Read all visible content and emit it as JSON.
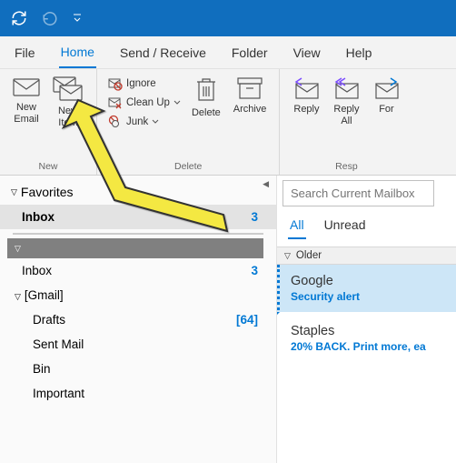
{
  "tabs": {
    "file": "File",
    "home": "Home",
    "send_receive": "Send / Receive",
    "folder": "Folder",
    "view": "View",
    "help": "Help"
  },
  "ribbon": {
    "new_group_label": "New",
    "delete_group_label": "Delete",
    "respond_group_label": "Resp",
    "new_email": "New\nEmail",
    "new_items": "New\nItem",
    "ignore": "Ignore",
    "clean_up": "Clean Up",
    "junk": "Junk",
    "delete": "Delete",
    "archive": "Archive",
    "reply": "Reply",
    "reply_all": "Reply\nAll",
    "forward": "For"
  },
  "sidebar": {
    "favorites": "Favorites",
    "inbox": "Inbox",
    "inbox_count": "3",
    "gmail_folder": "[Gmail]",
    "drafts": "Drafts",
    "drafts_count": "[64]",
    "sent": "Sent Mail",
    "bin": "Bin",
    "important": "Important"
  },
  "search": {
    "placeholder": "Search Current Mailbox"
  },
  "filters": {
    "all": "All",
    "unread": "Unread"
  },
  "groups": {
    "older": "Older"
  },
  "mail": [
    {
      "sender": "Google",
      "subject": "Security alert"
    },
    {
      "sender": "Staples",
      "subject": "20% BACK. Print more, ea"
    }
  ]
}
